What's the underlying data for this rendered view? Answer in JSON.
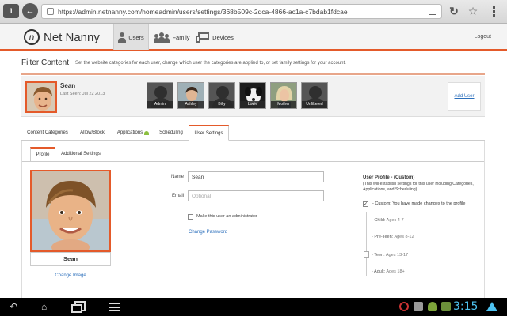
{
  "browser": {
    "tab_count": "1",
    "url": "https://admin.netnanny.com/homeadmin/users/settings/368b509c-2dca-4866-ac1a-c7bdab1fdcae"
  },
  "header": {
    "brand": "Net Nanny",
    "nav": [
      {
        "label": "Users",
        "icon": "user-icon",
        "active": true
      },
      {
        "label": "Family",
        "icon": "family-icon",
        "active": false
      },
      {
        "label": "Devices",
        "icon": "devices-icon",
        "active": false
      }
    ],
    "logout": "Logout"
  },
  "page": {
    "title": "Filter Content",
    "description": "Set the website categories for each user, change which user the categories are applied to, or set family settings for your account."
  },
  "selected_user": {
    "name": "Sean",
    "last_seen": "Last Seen: Jul 22 2013"
  },
  "user_thumbs": [
    {
      "label": "Admin"
    },
    {
      "label": "Ashley"
    },
    {
      "label": "Billy"
    },
    {
      "label": "Louie"
    },
    {
      "label": "Mother"
    },
    {
      "label": "Unfiltered"
    }
  ],
  "add_user": "Add User",
  "tabs": [
    {
      "label": "Content Categories"
    },
    {
      "label": "Allow/Block"
    },
    {
      "label": "Applications"
    },
    {
      "label": "Scheduling"
    },
    {
      "label": "User Settings",
      "active": true
    }
  ],
  "subtabs": [
    {
      "label": "Profile",
      "active": true
    },
    {
      "label": "Additional Settings"
    }
  ],
  "profile_photo_name": "Sean",
  "change_image": "Change Image",
  "form": {
    "name_label": "Name",
    "name_value": "Sean",
    "email_label": "Email",
    "email_placeholder": "Optional",
    "admin_label": "Make this user an administrator",
    "change_password": "Change Password"
  },
  "user_profile": {
    "title": "User Profile - (Custom)",
    "description": "(This will establish settings for this user including Categories, Applications, and Scheduling)",
    "custom_text": "- Custom: You have made changes to the profile",
    "levels": [
      {
        "name": "- Child:",
        "ages": "Ages 4-7"
      },
      {
        "name": "- Pre-Teen:",
        "ages": "Ages 8-12"
      },
      {
        "name": "- Teen:",
        "ages": "Ages 13-17"
      },
      {
        "name": "- Adult:",
        "ages": "Ages 18+"
      }
    ]
  },
  "system": {
    "clock": "3:15"
  },
  "colors": {
    "accent": "#e45a2a",
    "link": "#2a6ebb",
    "clock": "#4ec2f0"
  }
}
